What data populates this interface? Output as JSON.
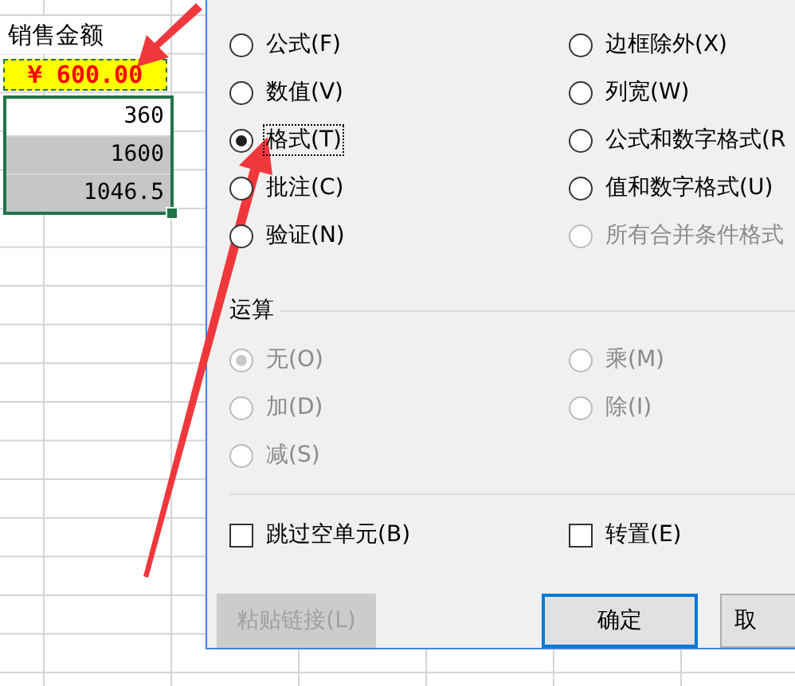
{
  "sheet": {
    "header": "销售金额",
    "copied_cell": "¥ 600.00",
    "cells": [
      {
        "value": "360",
        "shaded": false
      },
      {
        "value": "1600",
        "shaded": true
      },
      {
        "value": "1046.5",
        "shaded": true
      }
    ]
  },
  "dialog": {
    "paste_options": [
      {
        "label": "公式(F)",
        "selected": false,
        "disabled": false
      },
      {
        "label": "边框除外(X)",
        "selected": false,
        "disabled": false
      },
      {
        "label": "数值(V)",
        "selected": false,
        "disabled": false
      },
      {
        "label": "列宽(W)",
        "selected": false,
        "disabled": false
      },
      {
        "label": "格式(T)",
        "selected": true,
        "disabled": false
      },
      {
        "label": "公式和数字格式(R",
        "selected": false,
        "disabled": false
      },
      {
        "label": "批注(C)",
        "selected": false,
        "disabled": false
      },
      {
        "label": "值和数字格式(U)",
        "selected": false,
        "disabled": false
      },
      {
        "label": "验证(N)",
        "selected": false,
        "disabled": false
      },
      {
        "label": "所有合并条件格式",
        "selected": false,
        "disabled": true
      }
    ],
    "operation": {
      "title": "运算",
      "options": [
        {
          "label": "无(O)",
          "selected": true,
          "disabled": true
        },
        {
          "label": "乘(M)",
          "selected": false,
          "disabled": true
        },
        {
          "label": "加(D)",
          "selected": false,
          "disabled": true
        },
        {
          "label": "除(I)",
          "selected": false,
          "disabled": true
        },
        {
          "label": "减(S)",
          "selected": false,
          "disabled": true
        }
      ]
    },
    "checkboxes": [
      {
        "label": "跳过空单元(B)",
        "checked": false
      },
      {
        "label": "转置(E)",
        "checked": false
      }
    ],
    "buttons": [
      {
        "label": "粘贴链接(L)",
        "disabled": true,
        "default": false
      },
      {
        "label": "确定",
        "disabled": false,
        "default": true
      },
      {
        "label": "取",
        "disabled": false,
        "default": false
      }
    ]
  }
}
